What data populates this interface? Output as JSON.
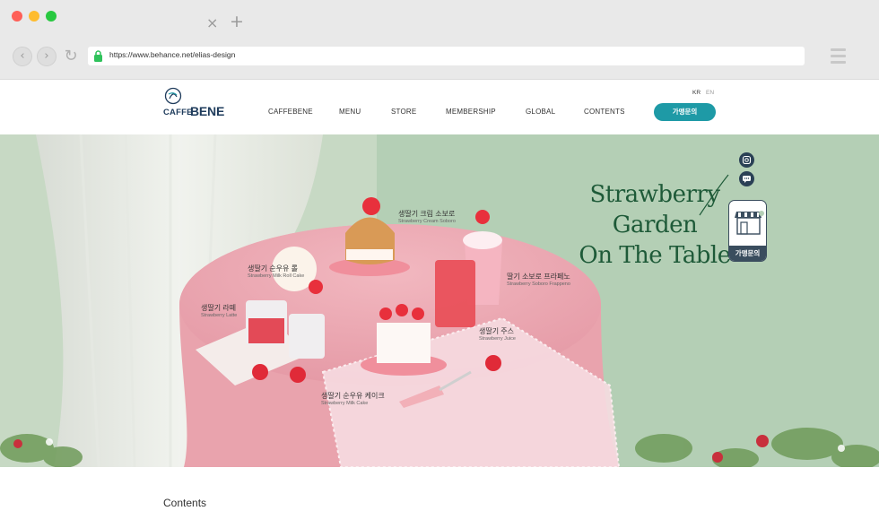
{
  "browser": {
    "url": "https://www.behance.net/elias-design",
    "tab_close": "×",
    "tab_new": "+",
    "back": "‹",
    "forward": "›",
    "reload": "↻",
    "dot_colors": [
      "#fe5f57",
      "#febc2e",
      "#28c840"
    ]
  },
  "header": {
    "logo_cafe": "CAFFE",
    "logo_bene": "BENE",
    "nav": [
      "CAFFEBENE",
      "MENU",
      "STORE",
      "MEMBERSHIP",
      "GLOBAL",
      "CONTENTS"
    ],
    "lang_kr": "KR",
    "lang_en": "EN",
    "franchise_button": "가맹문의",
    "accent_color": "#1e9aa6"
  },
  "hero": {
    "title_line1": "Strawberry",
    "title_line2": "Garden",
    "title_line3": "On The Table",
    "side_franchise_label": "가맹문의",
    "icons": [
      "instagram-icon",
      "chat-icon",
      "store-icon"
    ],
    "labels": [
      {
        "ko": "생딸기 크림 소보로",
        "en": "Strawberry Cream Soboro"
      },
      {
        "ko": "생딸기 순우유 롤",
        "en": "Strawberry Milk Roll Cake"
      },
      {
        "ko": "딸기 소보로 프라페노",
        "en": "Strawberry Soboro Frappeno"
      },
      {
        "ko": "생딸기 라떼",
        "en": "Strawberry Latte"
      },
      {
        "ko": "생딸기 주스",
        "en": "Strawberry Juice"
      },
      {
        "ko": "생딸기 순우유 케이크",
        "en": "Strawberry Milk Cake"
      }
    ]
  },
  "section": {
    "contents_title": "Contents"
  }
}
